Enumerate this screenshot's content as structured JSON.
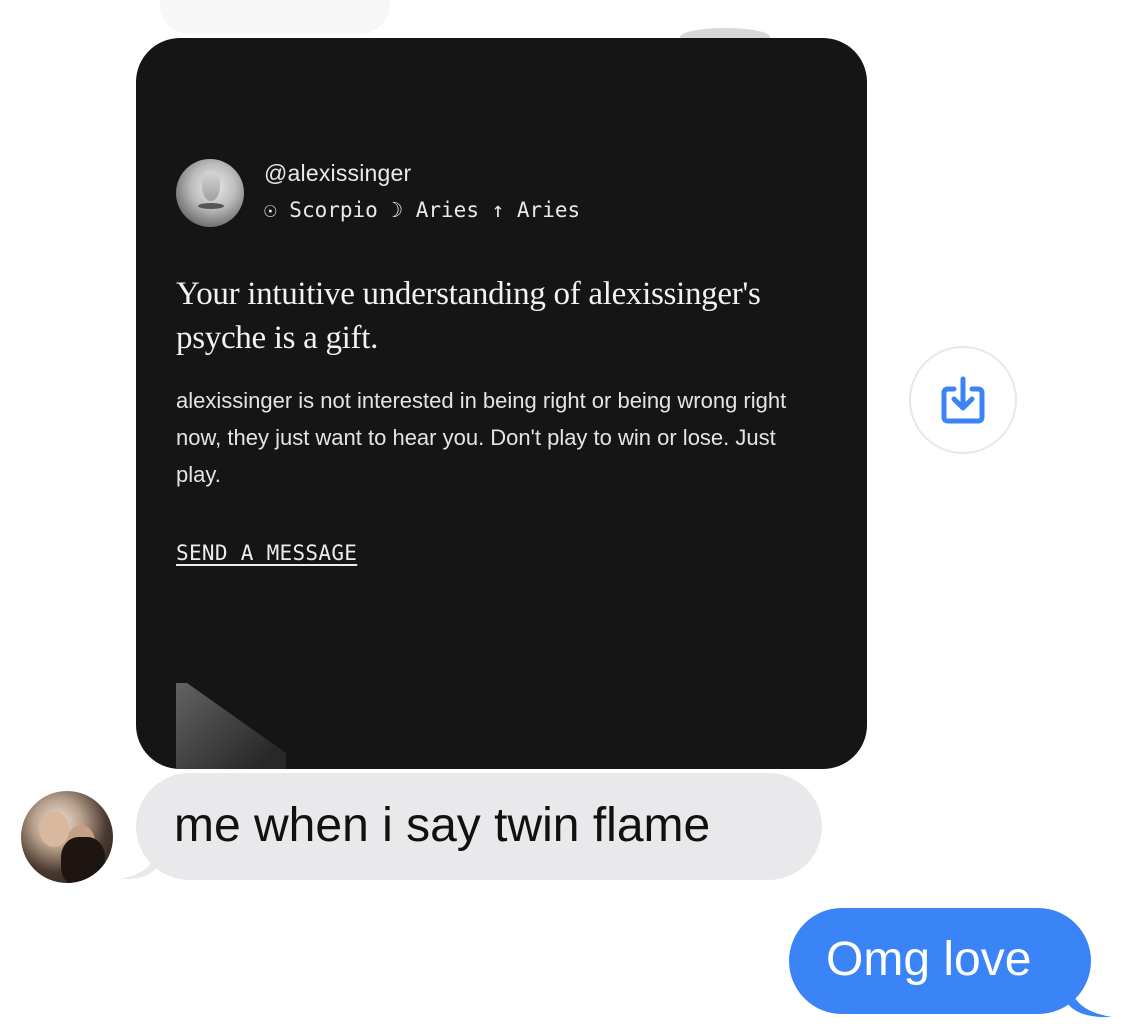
{
  "card": {
    "handle": "@alexissinger",
    "signs": {
      "sun_symbol": "☉",
      "sun": "Scorpio",
      "moon_symbol": "☽",
      "moon": "Aries",
      "rising_symbol": "↑",
      "rising": "Aries"
    },
    "headline": "Your intuitive understanding of alexissinger's psyche is a gift.",
    "body": "alexissinger is not interested in being right or being wrong right now, they just want to hear you. Don't play to win or lose. Just play.",
    "link_label": "SEND A MESSAGE"
  },
  "messages": {
    "incoming": "me when i say twin flame",
    "outgoing": "Omg love"
  },
  "colors": {
    "card_background": "#151515",
    "incoming_bubble": "#e9e9eb",
    "outgoing_bubble": "#3a84f7",
    "save_icon": "#3a84f7"
  },
  "icons": {
    "save_button": "download-tray-icon"
  }
}
